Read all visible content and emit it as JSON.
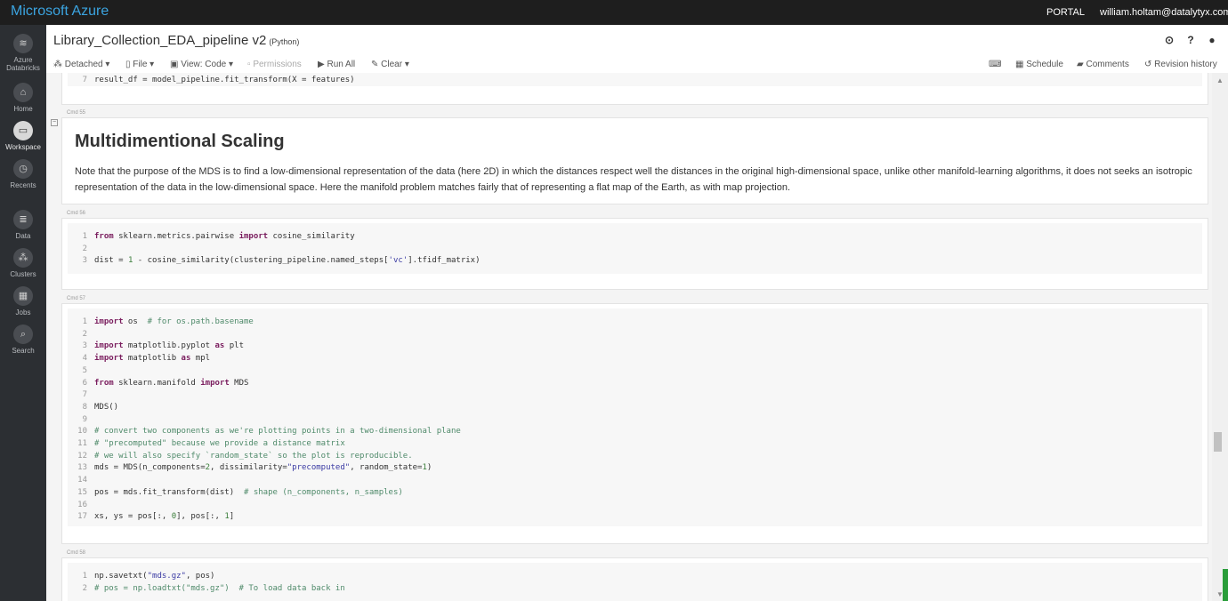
{
  "topbar": {
    "brand": "Microsoft Azure",
    "portal": "PORTAL",
    "user": "william.holtam@datalytyx.com"
  },
  "sidebar": {
    "items": [
      {
        "label": "Azure\nDatabricks",
        "icon": "databricks-stack-icon"
      },
      {
        "label": "Home",
        "icon": "home-icon"
      },
      {
        "label": "Workspace",
        "icon": "folder-icon",
        "active": true
      },
      {
        "label": "Recents",
        "icon": "clock-icon"
      },
      {
        "label": "Data",
        "icon": "database-icon"
      },
      {
        "label": "Clusters",
        "icon": "cluster-icon"
      },
      {
        "label": "Jobs",
        "icon": "calendar-icon"
      },
      {
        "label": "Search",
        "icon": "search-icon"
      }
    ]
  },
  "notebook": {
    "title": "Library_Collection_EDA_pipeline v2",
    "language": "(Python)"
  },
  "header_icons": [
    "history-clock-icon",
    "help-icon",
    "user-icon"
  ],
  "toolbar": {
    "detached": "Detached",
    "file": "File",
    "view": "View: Code",
    "permissions": "Permissions",
    "run_all": "Run All",
    "clear": "Clear",
    "schedule": "Schedule",
    "comments": "Comments",
    "revision_history": "Revision history"
  },
  "cells": {
    "prev": {
      "line_no": "7",
      "code": "result_df = model_pipeline.fit_transform(X = features)"
    },
    "cmd55": {
      "label": "Cmd 55",
      "heading": "Multidimentional Scaling",
      "paragraph": "Note that the purpose of the MDS is to find a low-dimensional representation of the data (here 2D) in which the distances respect well the distances in the original high-dimensional space, unlike other manifold-learning algorithms, it does not seeks an isotropic representation of the data in the low-dimensional space. Here the manifold problem matches fairly that of representing a flat map of the Earth, as with map projection."
    },
    "cmd56": {
      "label": "Cmd 56",
      "lines": [
        {
          "n": "1",
          "parts": [
            [
              "kw",
              "from"
            ],
            [
              "t",
              " sklearn.metrics.pairwise "
            ],
            [
              "kw",
              "import"
            ],
            [
              "t",
              " cosine_similarity"
            ]
          ]
        },
        {
          "n": "2",
          "parts": []
        },
        {
          "n": "3",
          "parts": [
            [
              "t",
              "dist = "
            ],
            [
              "num",
              "1"
            ],
            [
              "t",
              " - cosine_similarity(clustering_pipeline.named_steps["
            ],
            [
              "str",
              "'vc'"
            ],
            [
              "t",
              "].tfidf_matrix)"
            ]
          ]
        }
      ]
    },
    "cmd57": {
      "label": "Cmd 57",
      "lines": [
        {
          "n": "1",
          "parts": [
            [
              "kw",
              "import"
            ],
            [
              "t",
              " os  "
            ],
            [
              "cm",
              "# for os.path.basename"
            ]
          ]
        },
        {
          "n": "2",
          "parts": []
        },
        {
          "n": "3",
          "parts": [
            [
              "kw",
              "import"
            ],
            [
              "t",
              " matplotlib.pyplot "
            ],
            [
              "kw",
              "as"
            ],
            [
              "t",
              " plt"
            ]
          ]
        },
        {
          "n": "4",
          "parts": [
            [
              "kw",
              "import"
            ],
            [
              "t",
              " matplotlib "
            ],
            [
              "kw",
              "as"
            ],
            [
              "t",
              " mpl"
            ]
          ]
        },
        {
          "n": "5",
          "parts": []
        },
        {
          "n": "6",
          "parts": [
            [
              "kw",
              "from"
            ],
            [
              "t",
              " sklearn.manifold "
            ],
            [
              "kw",
              "import"
            ],
            [
              "t",
              " MDS"
            ]
          ]
        },
        {
          "n": "7",
          "parts": []
        },
        {
          "n": "8",
          "parts": [
            [
              "t",
              "MDS()"
            ]
          ]
        },
        {
          "n": "9",
          "parts": []
        },
        {
          "n": "10",
          "parts": [
            [
              "cm",
              "# convert two components as we're plotting points in a two-dimensional plane"
            ]
          ]
        },
        {
          "n": "11",
          "parts": [
            [
              "cm",
              "# \"precomputed\" because we provide a distance matrix"
            ]
          ]
        },
        {
          "n": "12",
          "parts": [
            [
              "cm",
              "# we will also specify `random_state` so the plot is reproducible."
            ]
          ]
        },
        {
          "n": "13",
          "parts": [
            [
              "t",
              "mds = MDS(n_components="
            ],
            [
              "num",
              "2"
            ],
            [
              "t",
              ", dissimilarity="
            ],
            [
              "str",
              "\"precomputed\""
            ],
            [
              "t",
              ", random_state="
            ],
            [
              "num",
              "1"
            ],
            [
              "t",
              ")"
            ]
          ]
        },
        {
          "n": "14",
          "parts": []
        },
        {
          "n": "15",
          "parts": [
            [
              "t",
              "pos = mds.fit_transform(dist)  "
            ],
            [
              "cm",
              "# shape (n_components, n_samples)"
            ]
          ]
        },
        {
          "n": "16",
          "parts": []
        },
        {
          "n": "17",
          "parts": [
            [
              "t",
              "xs, ys = pos[:, "
            ],
            [
              "num",
              "0"
            ],
            [
              "t",
              "], pos[:, "
            ],
            [
              "num",
              "1"
            ],
            [
              "t",
              "]"
            ]
          ]
        }
      ]
    },
    "cmd58": {
      "label": "Cmd 58",
      "lines": [
        {
          "n": "1",
          "parts": [
            [
              "t",
              "np.savetxt("
            ],
            [
              "str",
              "\"mds.gz\""
            ],
            [
              "t",
              ", pos)"
            ]
          ]
        },
        {
          "n": "2",
          "parts": [
            [
              "cm",
              "# pos = np.loadtxt(\"mds.gz\")  # To load data back in"
            ]
          ]
        }
      ]
    }
  }
}
